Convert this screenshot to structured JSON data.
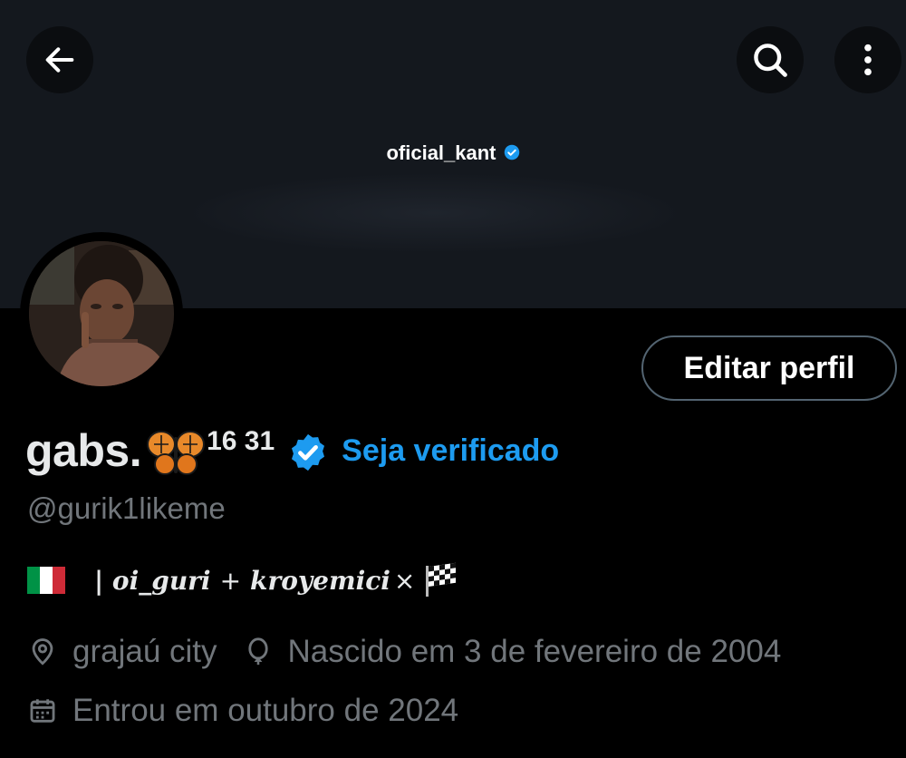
{
  "header": {
    "banner_handle": "oficial_kant",
    "back_icon": "arrow-left-icon",
    "search_icon": "search-icon",
    "more_icon": "more-vertical-icon"
  },
  "profile": {
    "display_name": "gabs.",
    "name_emoji": "butterfly",
    "name_suffix": "16 31",
    "get_verified_label": "Seja verificado",
    "username": "@gurik1likeme",
    "edit_button_label": "Editar perfil"
  },
  "bio": {
    "flag": "italy-flag",
    "part1": "| oi_guri",
    "plus": "+",
    "part2": "kroyemici",
    "times": "×",
    "end_flag": "checkered-flag"
  },
  "meta": {
    "location": "grajaú city",
    "birthday": "Nascido em 3 de fevereiro de 2004",
    "joined": "Entrou em outubro de 2024"
  },
  "colors": {
    "accent": "#1d9bf0",
    "muted": "#71767b",
    "banner": "#14181e",
    "background": "#000000"
  }
}
